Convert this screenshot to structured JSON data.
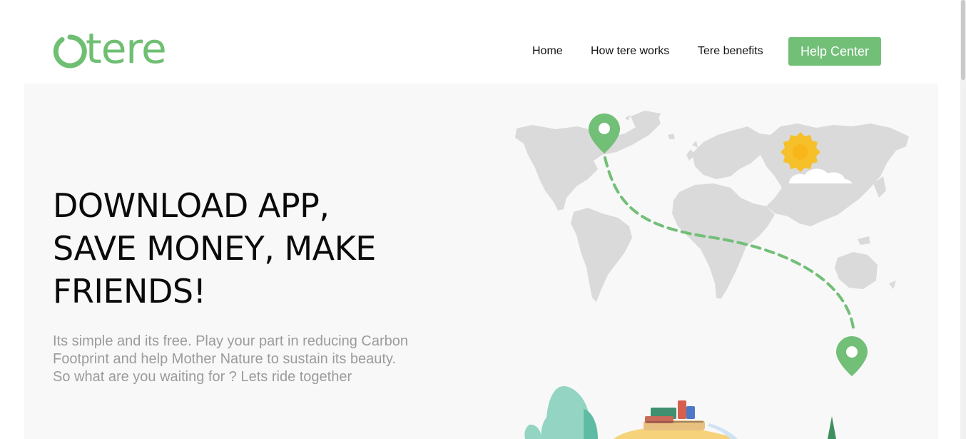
{
  "header": {
    "logo_text": "tere",
    "nav": {
      "home": "Home",
      "how_it_works": "How tere works",
      "benefits": "Tere benefits"
    },
    "help_button": "Help Center"
  },
  "hero": {
    "headline": [
      "DOWNLOAD APP,",
      "SAVE MONEY, MAKE",
      "FRIENDS!"
    ],
    "subtext": "Its simple and its free. Play your part in reducing Carbon Footprint and help Mother Nature to sustain its beauty. So what are you waiting for ? Lets ride together"
  },
  "colors": {
    "brand_green": "#72bf78",
    "map_gray": "#dadada",
    "sun_yellow": "#f5c02a"
  },
  "icons": [
    "logo-ring-icon",
    "map-pin-icon",
    "sun-icon",
    "cloud-icon",
    "tree-icon",
    "car-icon"
  ]
}
